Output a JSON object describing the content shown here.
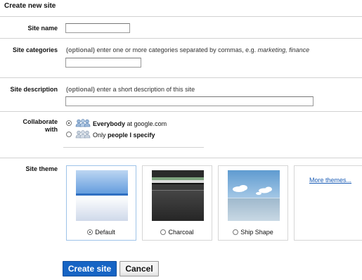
{
  "page": {
    "title": "Create new site"
  },
  "fields": {
    "site_name": {
      "label": "Site name",
      "value": ""
    },
    "site_categories": {
      "label": "Site categories",
      "hint_optional": "(optional)",
      "hint_text": " enter one or more categories separated by commas, e.g. ",
      "hint_example": "marketing, finance",
      "value": ""
    },
    "site_description": {
      "label": "Site description",
      "hint_optional": "(optional)",
      "hint_text": " enter a short description of this site",
      "value": ""
    }
  },
  "collaborate": {
    "label_line1": "Collaborate",
    "label_line2": "with",
    "options": [
      {
        "bold": "Everybody",
        "rest": " at google.com",
        "selected": true,
        "icon": "people-icon"
      },
      {
        "prefix": "Only ",
        "bold": "people I specify",
        "selected": false,
        "icon": "people-icon"
      }
    ]
  },
  "theme": {
    "label": "Site theme",
    "options": [
      {
        "name": "Default",
        "selected": true
      },
      {
        "name": "Charcoal",
        "selected": false
      },
      {
        "name": "Ship Shape",
        "selected": false
      }
    ],
    "more_link": "More themes..."
  },
  "actions": {
    "create": "Create site",
    "cancel": "Cancel"
  },
  "colors": {
    "primary_button": "#1664c4",
    "link": "#1a5cb5",
    "selected_border": "#9ec3e8"
  }
}
